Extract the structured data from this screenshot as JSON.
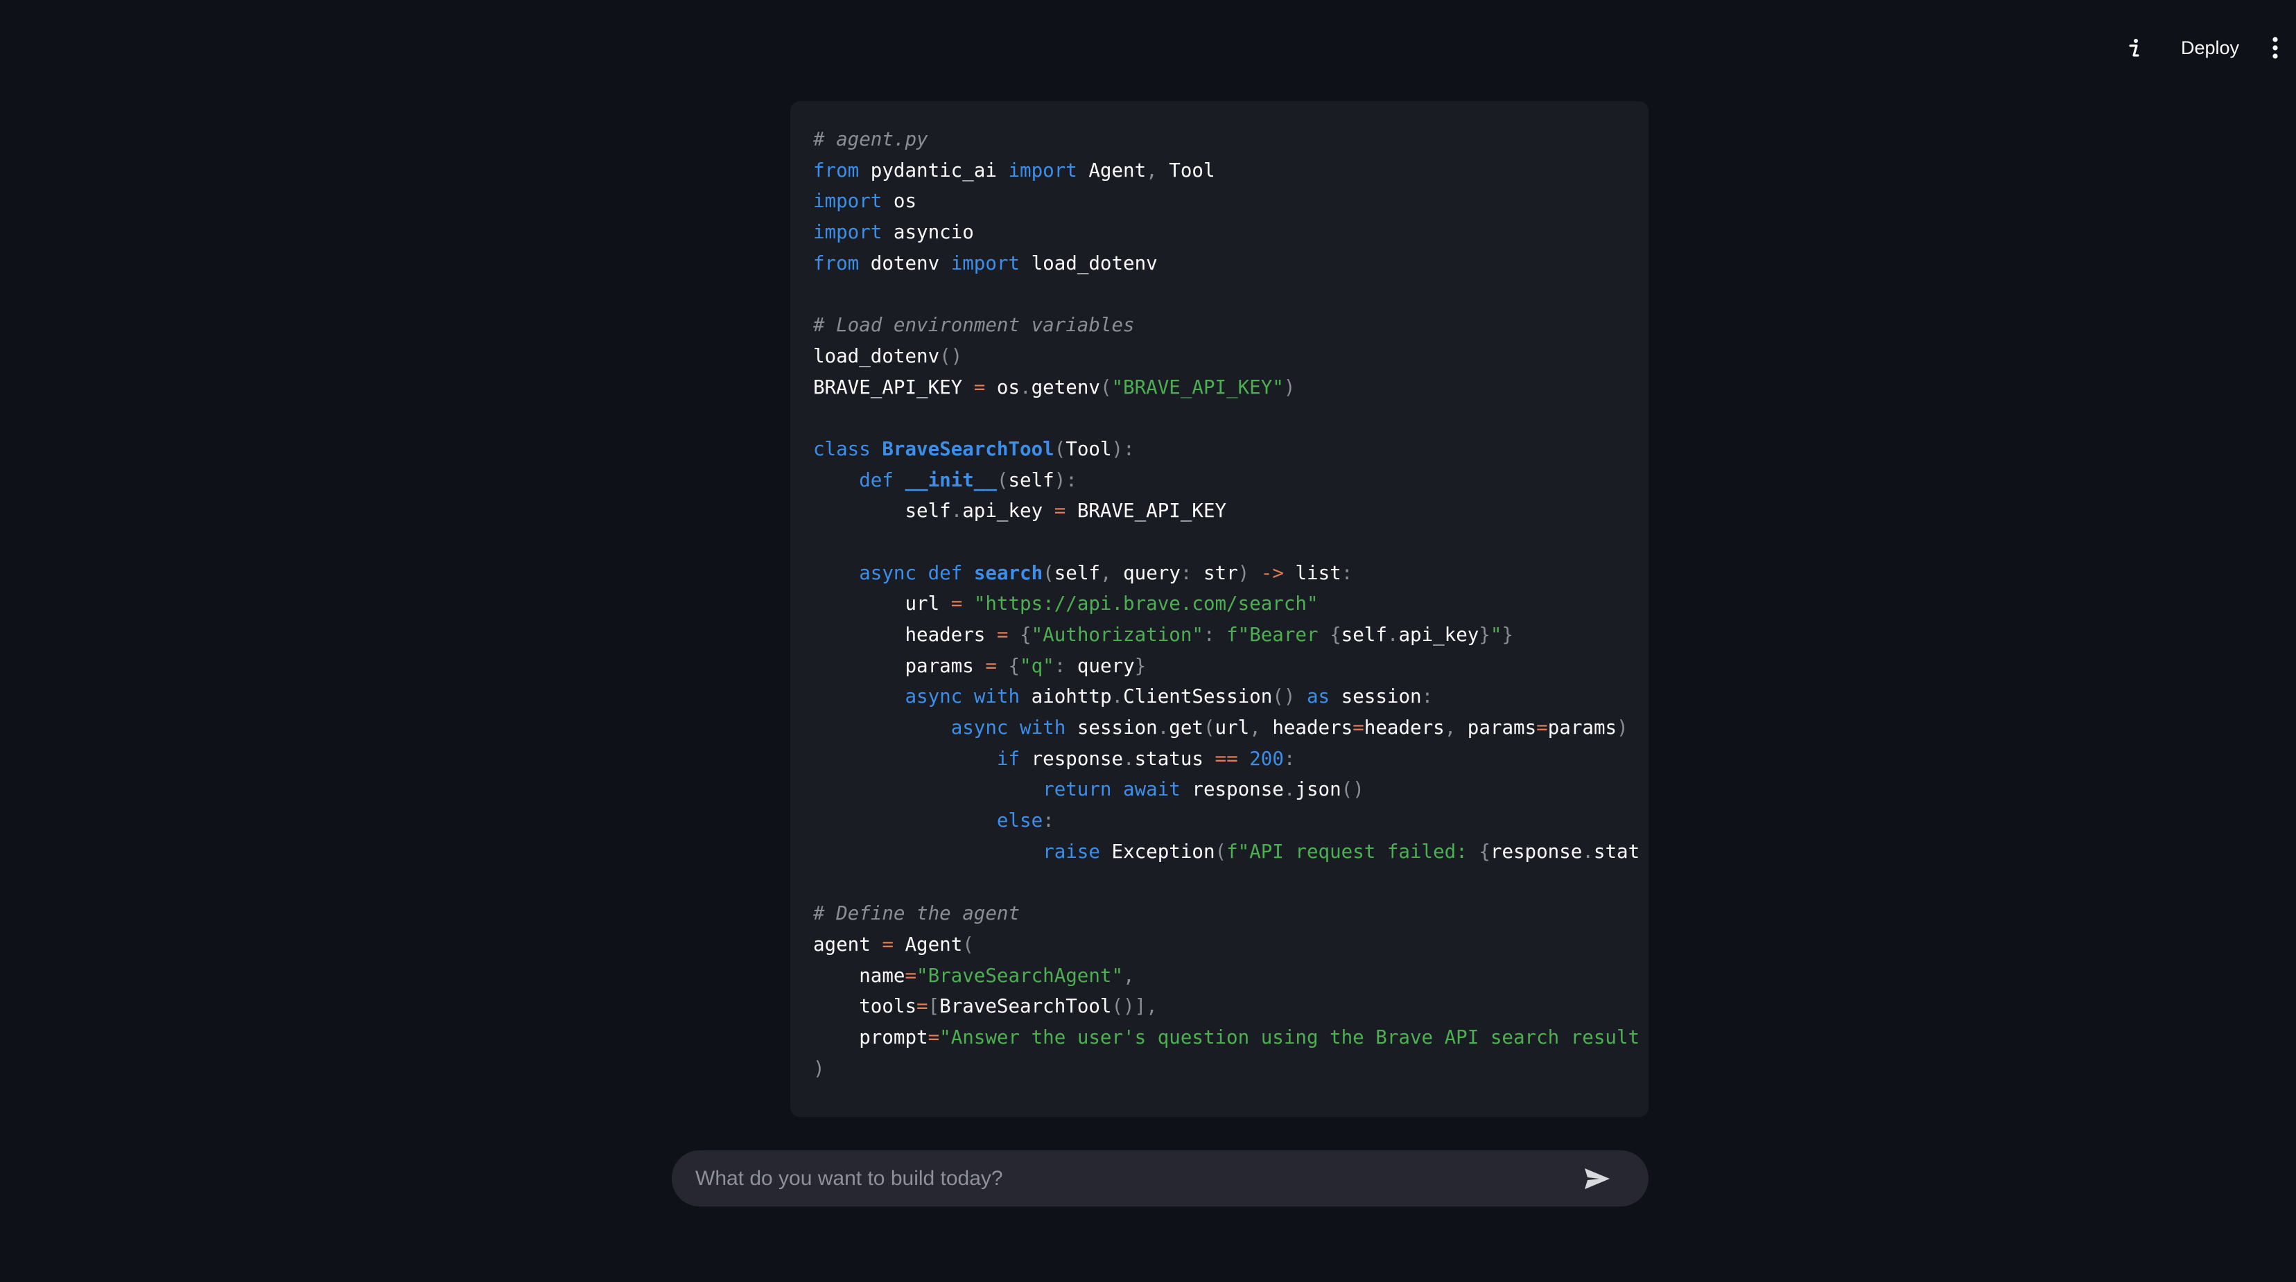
{
  "header": {
    "deploy_label": "Deploy",
    "info_icon": "info-icon",
    "menu_icon": "more-vertical-icon"
  },
  "code_block": {
    "language": "python",
    "lines": [
      [
        {
          "t": "# agent.py",
          "c": "com"
        }
      ],
      [
        {
          "t": "from",
          "c": "kw"
        },
        {
          "t": " pydantic_ai "
        },
        {
          "t": "import",
          "c": "kw"
        },
        {
          "t": " Agent"
        },
        {
          "t": ",",
          "c": "pun"
        },
        {
          "t": " Tool"
        }
      ],
      [
        {
          "t": "import",
          "c": "kw"
        },
        {
          "t": " os"
        }
      ],
      [
        {
          "t": "import",
          "c": "kw"
        },
        {
          "t": " asyncio"
        }
      ],
      [
        {
          "t": "from",
          "c": "kw"
        },
        {
          "t": " dotenv "
        },
        {
          "t": "import",
          "c": "kw"
        },
        {
          "t": " load_dotenv"
        }
      ],
      [],
      [
        {
          "t": "# Load environment variables",
          "c": "com"
        }
      ],
      [
        {
          "t": "load_dotenv"
        },
        {
          "t": "()",
          "c": "pun"
        }
      ],
      [
        {
          "t": "BRAVE_API_KEY "
        },
        {
          "t": "=",
          "c": "op"
        },
        {
          "t": " os"
        },
        {
          "t": ".",
          "c": "pun"
        },
        {
          "t": "getenv"
        },
        {
          "t": "(",
          "c": "pun"
        },
        {
          "t": "\"BRAVE_API_KEY\"",
          "c": "str"
        },
        {
          "t": ")",
          "c": "pun"
        }
      ],
      [],
      [
        {
          "t": "class",
          "c": "kw"
        },
        {
          "t": " "
        },
        {
          "t": "BraveSearchTool",
          "c": "fn"
        },
        {
          "t": "(",
          "c": "pun"
        },
        {
          "t": "Tool"
        },
        {
          "t": "):",
          "c": "pun"
        }
      ],
      [
        {
          "t": "    "
        },
        {
          "t": "def",
          "c": "kw"
        },
        {
          "t": " "
        },
        {
          "t": "__init__",
          "c": "fn"
        },
        {
          "t": "(",
          "c": "pun"
        },
        {
          "t": "self"
        },
        {
          "t": "):",
          "c": "pun"
        }
      ],
      [
        {
          "t": "        self"
        },
        {
          "t": ".",
          "c": "pun"
        },
        {
          "t": "api_key "
        },
        {
          "t": "=",
          "c": "op"
        },
        {
          "t": " BRAVE_API_KEY"
        }
      ],
      [],
      [
        {
          "t": "    "
        },
        {
          "t": "async",
          "c": "kw"
        },
        {
          "t": " "
        },
        {
          "t": "def",
          "c": "kw"
        },
        {
          "t": " "
        },
        {
          "t": "search",
          "c": "fn"
        },
        {
          "t": "(",
          "c": "pun"
        },
        {
          "t": "self"
        },
        {
          "t": ",",
          "c": "pun"
        },
        {
          "t": " query"
        },
        {
          "t": ":",
          "c": "pun"
        },
        {
          "t": " str"
        },
        {
          "t": ")",
          "c": "pun"
        },
        {
          "t": " "
        },
        {
          "t": "->",
          "c": "op"
        },
        {
          "t": " list"
        },
        {
          "t": ":",
          "c": "pun"
        }
      ],
      [
        {
          "t": "        url "
        },
        {
          "t": "=",
          "c": "op"
        },
        {
          "t": " "
        },
        {
          "t": "\"https://api.brave.com/search\"",
          "c": "str"
        }
      ],
      [
        {
          "t": "        headers "
        },
        {
          "t": "=",
          "c": "op"
        },
        {
          "t": " "
        },
        {
          "t": "{",
          "c": "pun"
        },
        {
          "t": "\"Authorization\"",
          "c": "str"
        },
        {
          "t": ":",
          "c": "pun"
        },
        {
          "t": " "
        },
        {
          "t": "f\"Bearer ",
          "c": "str"
        },
        {
          "t": "{",
          "c": "pun"
        },
        {
          "t": "self"
        },
        {
          "t": ".",
          "c": "pun"
        },
        {
          "t": "api_key"
        },
        {
          "t": "}",
          "c": "pun"
        },
        {
          "t": "\"",
          "c": "str"
        },
        {
          "t": "}",
          "c": "pun"
        }
      ],
      [
        {
          "t": "        params "
        },
        {
          "t": "=",
          "c": "op"
        },
        {
          "t": " "
        },
        {
          "t": "{",
          "c": "pun"
        },
        {
          "t": "\"q\"",
          "c": "str"
        },
        {
          "t": ":",
          "c": "pun"
        },
        {
          "t": " query"
        },
        {
          "t": "}",
          "c": "pun"
        }
      ],
      [
        {
          "t": "        "
        },
        {
          "t": "async",
          "c": "kw"
        },
        {
          "t": " "
        },
        {
          "t": "with",
          "c": "kw"
        },
        {
          "t": " aiohttp"
        },
        {
          "t": ".",
          "c": "pun"
        },
        {
          "t": "ClientSession"
        },
        {
          "t": "()",
          "c": "pun"
        },
        {
          "t": " "
        },
        {
          "t": "as",
          "c": "kw"
        },
        {
          "t": " session"
        },
        {
          "t": ":",
          "c": "pun"
        }
      ],
      [
        {
          "t": "            "
        },
        {
          "t": "async",
          "c": "kw"
        },
        {
          "t": " "
        },
        {
          "t": "with",
          "c": "kw"
        },
        {
          "t": " session"
        },
        {
          "t": ".",
          "c": "pun"
        },
        {
          "t": "get"
        },
        {
          "t": "(",
          "c": "pun"
        },
        {
          "t": "url"
        },
        {
          "t": ",",
          "c": "pun"
        },
        {
          "t": " headers"
        },
        {
          "t": "=",
          "c": "op"
        },
        {
          "t": "headers"
        },
        {
          "t": ",",
          "c": "pun"
        },
        {
          "t": " params"
        },
        {
          "t": "=",
          "c": "op"
        },
        {
          "t": "params"
        },
        {
          "t": ")",
          "c": "pun"
        }
      ],
      [
        {
          "t": "                "
        },
        {
          "t": "if",
          "c": "kw"
        },
        {
          "t": " response"
        },
        {
          "t": ".",
          "c": "pun"
        },
        {
          "t": "status "
        },
        {
          "t": "==",
          "c": "op"
        },
        {
          "t": " "
        },
        {
          "t": "200",
          "c": "num"
        },
        {
          "t": ":",
          "c": "pun"
        }
      ],
      [
        {
          "t": "                    "
        },
        {
          "t": "return",
          "c": "kw"
        },
        {
          "t": " "
        },
        {
          "t": "await",
          "c": "kw"
        },
        {
          "t": " response"
        },
        {
          "t": ".",
          "c": "pun"
        },
        {
          "t": "json"
        },
        {
          "t": "()",
          "c": "pun"
        }
      ],
      [
        {
          "t": "                "
        },
        {
          "t": "else",
          "c": "kw"
        },
        {
          "t": ":",
          "c": "pun"
        }
      ],
      [
        {
          "t": "                    "
        },
        {
          "t": "raise",
          "c": "kw"
        },
        {
          "t": " Exception"
        },
        {
          "t": "(",
          "c": "pun"
        },
        {
          "t": "f\"API request failed: ",
          "c": "str"
        },
        {
          "t": "{",
          "c": "pun"
        },
        {
          "t": "response"
        },
        {
          "t": ".",
          "c": "pun"
        },
        {
          "t": "stat"
        }
      ],
      [],
      [
        {
          "t": "# Define the agent",
          "c": "com"
        }
      ],
      [
        {
          "t": "agent "
        },
        {
          "t": "=",
          "c": "op"
        },
        {
          "t": " Agent"
        },
        {
          "t": "(",
          "c": "pun"
        }
      ],
      [
        {
          "t": "    name"
        },
        {
          "t": "=",
          "c": "op"
        },
        {
          "t": "\"BraveSearchAgent\"",
          "c": "str"
        },
        {
          "t": ",",
          "c": "pun"
        }
      ],
      [
        {
          "t": "    tools"
        },
        {
          "t": "=",
          "c": "op"
        },
        {
          "t": "[",
          "c": "pun"
        },
        {
          "t": "BraveSearchTool"
        },
        {
          "t": "()]",
          "c": "pun"
        },
        {
          "t": ",",
          "c": "pun"
        }
      ],
      [
        {
          "t": "    prompt"
        },
        {
          "t": "=",
          "c": "op"
        },
        {
          "t": "\"Answer the user's question using the Brave API search result",
          "c": "str"
        }
      ],
      [
        {
          "t": ")",
          "c": "pun"
        }
      ]
    ]
  },
  "chat_input": {
    "placeholder": "What do you want to build today?",
    "value": "",
    "send_icon": "send-icon"
  }
}
